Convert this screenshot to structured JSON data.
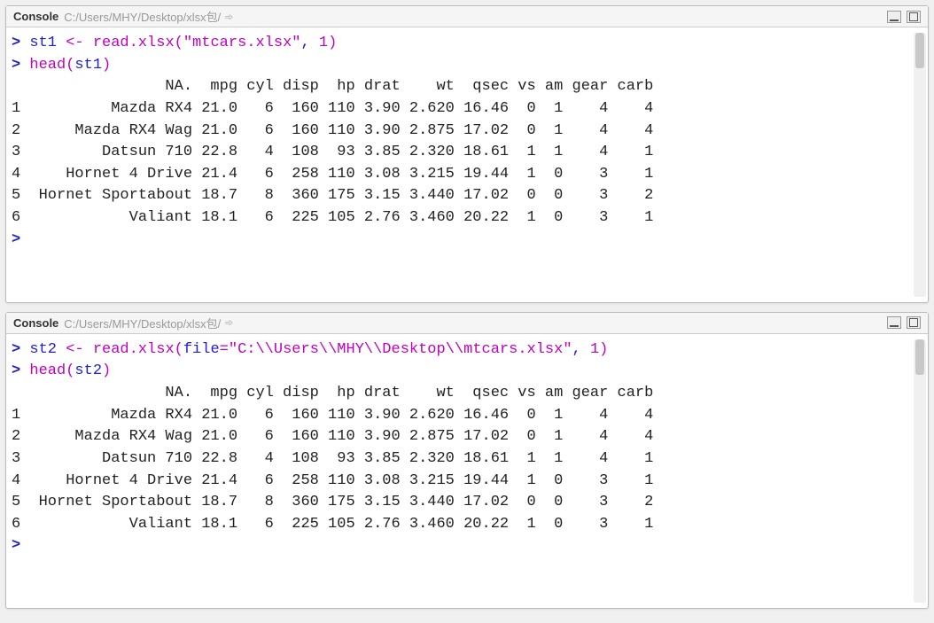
{
  "panels": [
    {
      "title": "Console",
      "path": "C:/Users/MHY/Desktop/xlsx包/",
      "arrow": "➾",
      "lines": [
        {
          "type": "cmd",
          "prompt": "> ",
          "parts": [
            "st1 ",
            "<-",
            " ",
            "read.xlsx",
            "(",
            "\"mtcars.xlsx\"",
            ", ",
            "1",
            ")"
          ]
        },
        {
          "type": "cmd",
          "prompt": "> ",
          "parts": [
            "head",
            "(",
            "st1",
            ")"
          ]
        },
        {
          "type": "out",
          "text": "                 NA.  mpg cyl disp  hp drat    wt  qsec vs am gear carb"
        },
        {
          "type": "out",
          "text": "1          Mazda RX4 21.0   6  160 110 3.90 2.620 16.46  0  1    4    4"
        },
        {
          "type": "out",
          "text": "2      Mazda RX4 Wag 21.0   6  160 110 3.90 2.875 17.02  0  1    4    4"
        },
        {
          "type": "out",
          "text": "3         Datsun 710 22.8   4  108  93 3.85 2.320 18.61  1  1    4    1"
        },
        {
          "type": "out",
          "text": "4     Hornet 4 Drive 21.4   6  258 110 3.08 3.215 19.44  1  0    3    1"
        },
        {
          "type": "out",
          "text": "5  Hornet Sportabout 18.7   8  360 175 3.15 3.440 17.02  0  0    3    2"
        },
        {
          "type": "out",
          "text": "6            Valiant 18.1   6  225 105 2.76 3.460 20.22  1  0    3    1"
        },
        {
          "type": "cmd",
          "prompt": "> ",
          "parts": []
        }
      ]
    },
    {
      "title": "Console",
      "path": "C:/Users/MHY/Desktop/xlsx包/",
      "arrow": "➾",
      "lines": [
        {
          "type": "cmd",
          "prompt": "> ",
          "parts": [
            "st2 ",
            "<-",
            " ",
            "read.xlsx",
            "(",
            "file",
            "=",
            "\"C:\\\\Users\\\\MHY\\\\Desktop\\\\mtcars.xlsx\"",
            ", ",
            "1",
            ")"
          ]
        },
        {
          "type": "cmd",
          "prompt": "> ",
          "parts": [
            "head",
            "(",
            "st2",
            ")"
          ]
        },
        {
          "type": "out",
          "text": "                 NA.  mpg cyl disp  hp drat    wt  qsec vs am gear carb"
        },
        {
          "type": "out",
          "text": "1          Mazda RX4 21.0   6  160 110 3.90 2.620 16.46  0  1    4    4"
        },
        {
          "type": "out",
          "text": "2      Mazda RX4 Wag 21.0   6  160 110 3.90 2.875 17.02  0  1    4    4"
        },
        {
          "type": "out",
          "text": "3         Datsun 710 22.8   4  108  93 3.85 2.320 18.61  1  1    4    1"
        },
        {
          "type": "out",
          "text": "4     Hornet 4 Drive 21.4   6  258 110 3.08 3.215 19.44  1  0    3    1"
        },
        {
          "type": "out",
          "text": "5  Hornet Sportabout 18.7   8  360 175 3.15 3.440 17.02  0  0    3    2"
        },
        {
          "type": "out",
          "text": "6            Valiant 18.1   6  225 105 2.76 3.460 20.22  1  0    3    1"
        },
        {
          "type": "cmd",
          "prompt": "> ",
          "parts": []
        }
      ]
    }
  ]
}
